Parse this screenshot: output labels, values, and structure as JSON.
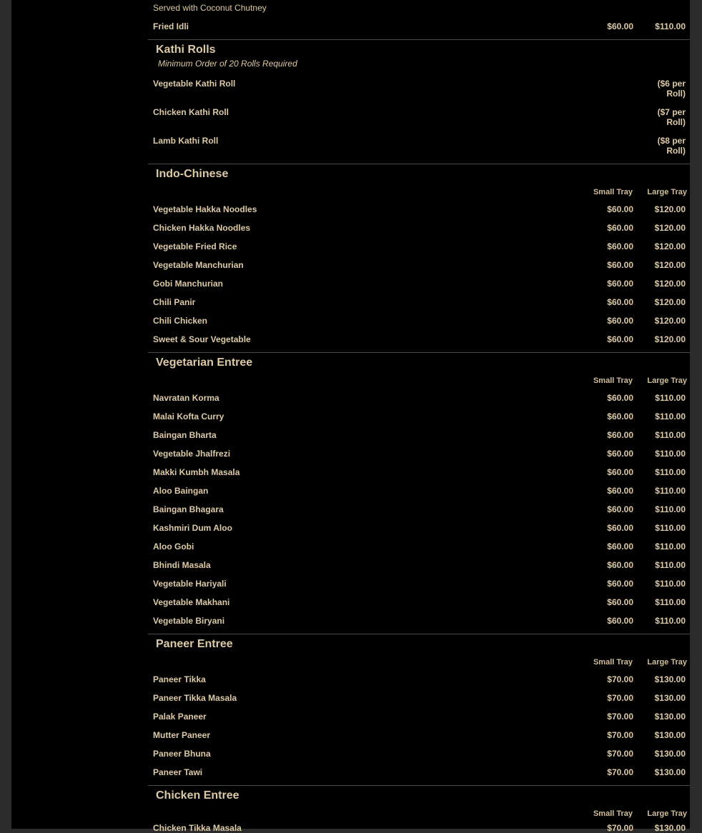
{
  "top": {
    "served_note": "Served with Coconut Chutney",
    "item": {
      "name": "Fried Idli",
      "small": "$60.00",
      "large": "$110.00"
    }
  },
  "kathi": {
    "title": "Kathi Rolls",
    "note": "Minimum Order of 20 Rolls Required",
    "items": [
      {
        "name": "Vegetable Kathi Roll",
        "price_l1": "($6 per",
        "price_l2": "Roll)"
      },
      {
        "name": "Chicken Kathi Roll",
        "price_l1": "($7 per",
        "price_l2": "Roll)"
      },
      {
        "name": "Lamb Kathi Roll",
        "price_l1": "($8 per",
        "price_l2": "Roll)"
      }
    ]
  },
  "headers": {
    "small": "Small Tray",
    "large": "Large Tray"
  },
  "indo": {
    "title": "Indo-Chinese",
    "items": [
      {
        "name": "Vegetable Hakka Noodles",
        "small": "$60.00",
        "large": "$120.00"
      },
      {
        "name": "Chicken Hakka Noodles",
        "small": "$60.00",
        "large": "$120.00"
      },
      {
        "name": "Vegetable Fried Rice",
        "small": "$60.00",
        "large": "$120.00"
      },
      {
        "name": "Vegetable Manchurian",
        "small": "$60.00",
        "large": "$120.00"
      },
      {
        "name": "Gobi Manchurian",
        "small": "$60.00",
        "large": "$120.00"
      },
      {
        "name": "Chili Panir",
        "small": "$60.00",
        "large": "$120.00"
      },
      {
        "name": "Chili Chicken",
        "small": "$60.00",
        "large": "$120.00"
      },
      {
        "name": "Sweet & Sour Vegetable",
        "small": "$60.00",
        "large": "$120.00"
      }
    ]
  },
  "veg": {
    "title": "Vegetarian Entree",
    "items": [
      {
        "name": "Navratan Korma",
        "small": "$60.00",
        "large": "$110.00"
      },
      {
        "name": "Malai Kofta Curry",
        "small": "$60.00",
        "large": "$110.00"
      },
      {
        "name": "Baingan Bharta",
        "small": "$60.00",
        "large": "$110.00"
      },
      {
        "name": "Vegetable Jhalfrezi",
        "small": "$60.00",
        "large": "$110.00"
      },
      {
        "name": "Makki Kumbh Masala",
        "small": "$60.00",
        "large": "$110.00"
      },
      {
        "name": "Aloo Baingan",
        "small": "$60.00",
        "large": "$110.00"
      },
      {
        "name": "Baingan Bhagara",
        "small": "$60.00",
        "large": "$110.00"
      },
      {
        "name": "Kashmiri Dum Aloo",
        "small": "$60.00",
        "large": "$110.00"
      },
      {
        "name": "Aloo Gobi",
        "small": "$60.00",
        "large": "$110.00"
      },
      {
        "name": "Bhindi Masala",
        "small": "$60.00",
        "large": "$110.00"
      },
      {
        "name": "Vegetable Hariyali",
        "small": "$60.00",
        "large": "$110.00"
      },
      {
        "name": "Vegetable Makhani",
        "small": "$60.00",
        "large": "$110.00"
      },
      {
        "name": "Vegetable Biryani",
        "small": "$60.00",
        "large": "$110.00"
      }
    ]
  },
  "paneer": {
    "title": "Paneer Entree",
    "items": [
      {
        "name": "Paneer Tikka",
        "small": "$70.00",
        "large": "$130.00"
      },
      {
        "name": "Paneer Tikka Masala",
        "small": "$70.00",
        "large": "$130.00"
      },
      {
        "name": "Palak Paneer",
        "small": "$70.00",
        "large": "$130.00"
      },
      {
        "name": "Mutter Paneer",
        "small": "$70.00",
        "large": "$130.00"
      },
      {
        "name": "Paneer Bhuna",
        "small": "$70.00",
        "large": "$130.00"
      },
      {
        "name": "Paneer Tawi",
        "small": "$70.00",
        "large": "$130.00"
      }
    ]
  },
  "chicken": {
    "title": "Chicken Entree",
    "items": [
      {
        "name": "Chicken Tikka Masala",
        "small": "$70.00",
        "large": "$130.00"
      }
    ]
  }
}
